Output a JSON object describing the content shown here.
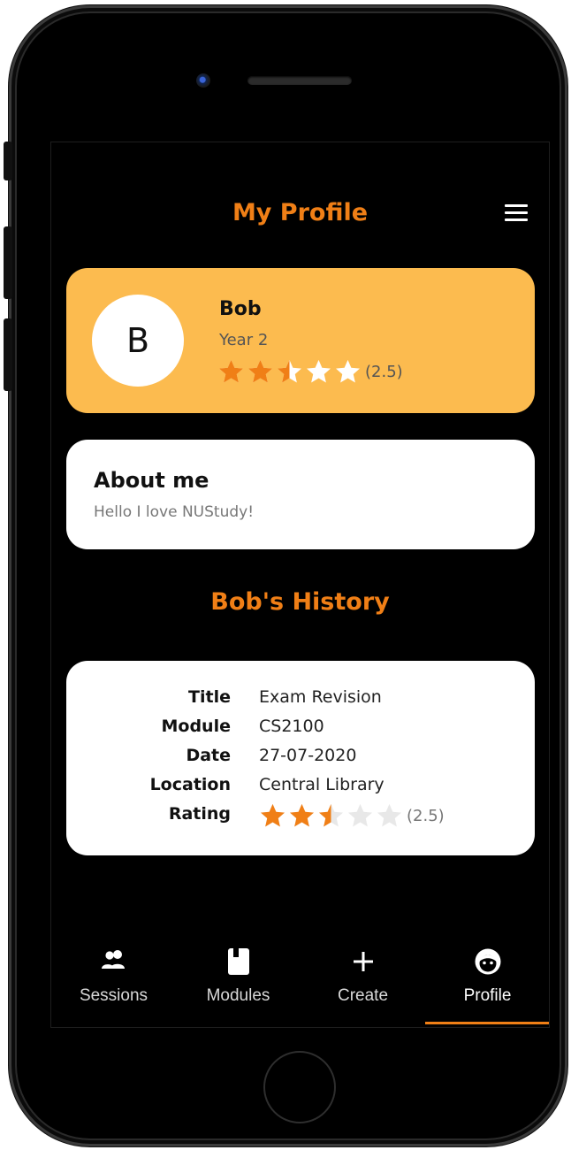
{
  "header": {
    "title": "My Profile",
    "menu_icon": "hamburger-menu-icon"
  },
  "profile": {
    "initial": "B",
    "name": "Bob",
    "year": "Year 2",
    "rating": 2.5,
    "rating_text": "(2.5)"
  },
  "about": {
    "title": "About me",
    "text": "Hello I love NUStudy!"
  },
  "history": {
    "title": "Bob's History",
    "rows": [
      {
        "label": "Title",
        "value": "Exam Revision"
      },
      {
        "label": "Module",
        "value": "CS2100"
      },
      {
        "label": "Date",
        "value": "27-07-2020"
      },
      {
        "label": "Location",
        "value": "Central Library"
      },
      {
        "label": "Rating",
        "rating": 2.5,
        "rating_text": "(2.5)"
      }
    ]
  },
  "tabs": [
    {
      "label": "Sessions",
      "icon": "people-icon"
    },
    {
      "label": "Modules",
      "icon": "book-icon"
    },
    {
      "label": "Create",
      "icon": "plus-icon"
    },
    {
      "label": "Profile",
      "icon": "face-icon",
      "active": true
    }
  ],
  "colors": {
    "accent": "#f07f16",
    "profile_card": "#fcbb4f",
    "star_filled": "#f07f16"
  }
}
